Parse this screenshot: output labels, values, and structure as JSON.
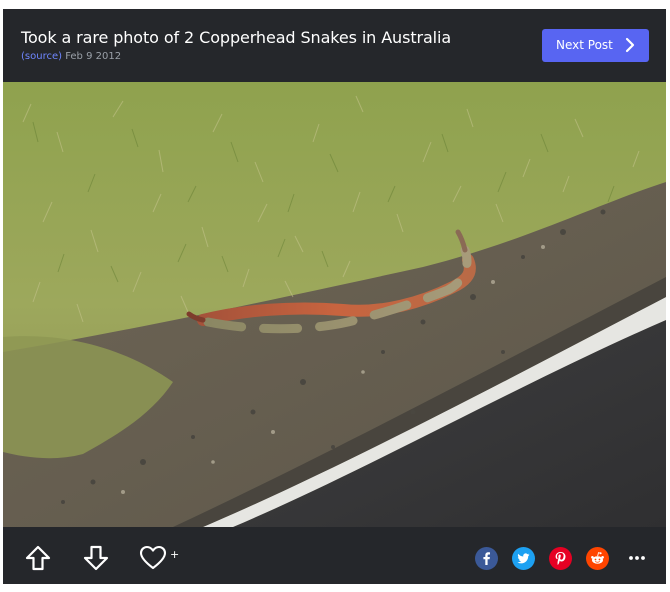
{
  "post": {
    "title": "Took a rare photo of 2 Copperhead Snakes in Australia",
    "source_label": "(source)",
    "date": "Feb 9 2012",
    "next_label": "Next Post"
  },
  "actions": {
    "upvote_icon": "arrow-up-outline-icon",
    "downvote_icon": "arrow-down-outline-icon",
    "favorite_icon": "heart-outline-icon",
    "favorite_plus": "+"
  },
  "share": {
    "facebook_glyph": "f",
    "twitter_icon": "bird-icon",
    "pinterest_glyph": "p",
    "reddit_icon": "alien-icon",
    "more_icon": "ellipsis-icon"
  },
  "colors": {
    "background": "#25272b",
    "accent": "#5865f2",
    "source_link": "#6e86ff",
    "facebook": "#3b5998",
    "twitter": "#1da1f2",
    "pinterest": "#e60023",
    "reddit": "#ff4500"
  }
}
